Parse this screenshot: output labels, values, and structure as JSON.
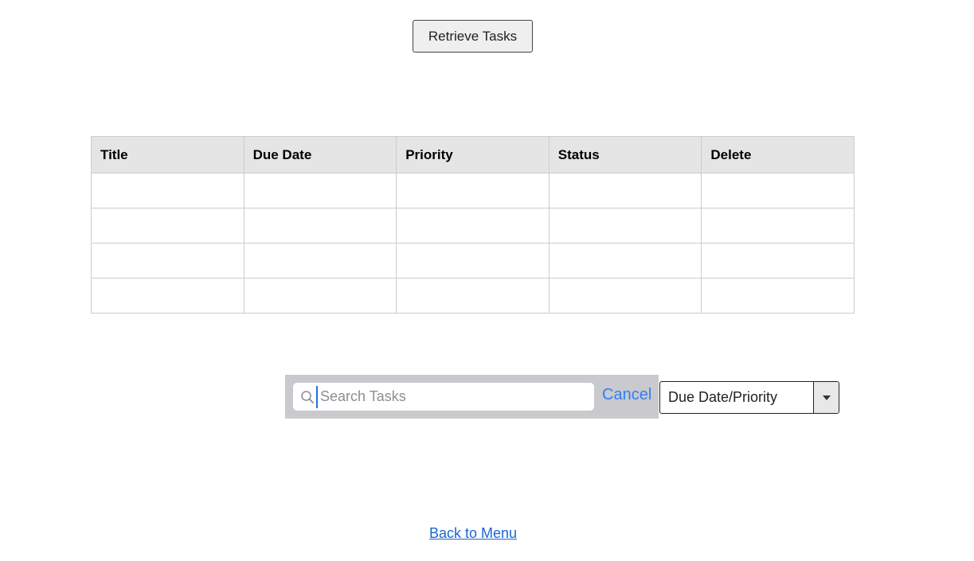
{
  "toolbar": {
    "retrieve_label": "Retrieve Tasks"
  },
  "table": {
    "columns": [
      "Title",
      "Due Date",
      "Priority",
      "Status",
      "Delete"
    ],
    "rows": [
      [
        "",
        "",
        "",
        "",
        ""
      ],
      [
        "",
        "",
        "",
        "",
        ""
      ],
      [
        "",
        "",
        "",
        "",
        ""
      ],
      [
        "",
        "",
        "",
        "",
        ""
      ]
    ]
  },
  "search": {
    "placeholder": "Search Tasks",
    "value": "",
    "cancel_label": "Cancel",
    "icon": "search-icon"
  },
  "sort": {
    "selected": "Due Date/Priority",
    "icon": "caret-down-icon"
  },
  "footer": {
    "back_label": "Back to Menu"
  },
  "colors": {
    "accent": "#2f7ff7",
    "link": "#1a66d1",
    "search_bar_bg": "#c9c9ce",
    "table_header_bg": "#e5e5e5"
  }
}
